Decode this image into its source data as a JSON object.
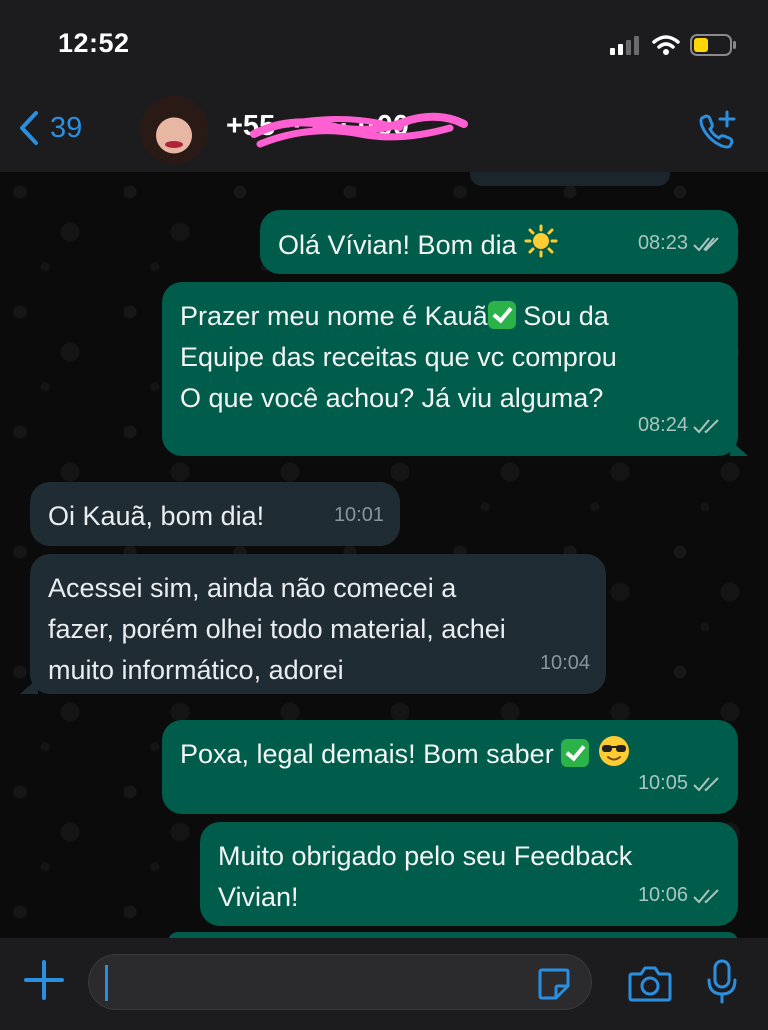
{
  "status_bar": {
    "time": "12:52"
  },
  "header": {
    "back_count": "39",
    "contact_name": "+55 ·· ···· ··00",
    "colors": {
      "accent": "#2b8fe0",
      "scribble": "#ff5fd0"
    }
  },
  "messages": [
    {
      "direction": "out",
      "text": "Olá Vívian! Bom dia",
      "emoji": "sun",
      "time": "08:23",
      "status": "read"
    },
    {
      "direction": "out",
      "lines": [
        "Prazer meu nome é Kauã",
        "Equipe das receitas que vc comprou",
        "O que você achou? Já viu alguma?"
      ],
      "line1_suffix": "Sou da",
      "time": "08:24",
      "status": "read"
    },
    {
      "direction": "in",
      "text": "Oi Kauã, bom dia!",
      "time": "10:01"
    },
    {
      "direction": "in",
      "lines": [
        "Acessei sim, ainda não comecei a",
        "fazer, porém olhei todo material, achei",
        "muito informático, adorei"
      ],
      "time": "10:04"
    },
    {
      "direction": "out",
      "text": "Poxa, legal demais! Bom saber",
      "time": "10:05",
      "status": "read"
    },
    {
      "direction": "out",
      "lines": [
        "Muito obrigado pelo seu Feedback",
        "Vivian!"
      ],
      "time": "10:06",
      "status": "read"
    }
  ],
  "colors": {
    "outgoing_bubble": "#005c4b",
    "incoming_bubble": "#202c33",
    "background": "#0b0b0b",
    "bar": "#1c1c1e"
  }
}
